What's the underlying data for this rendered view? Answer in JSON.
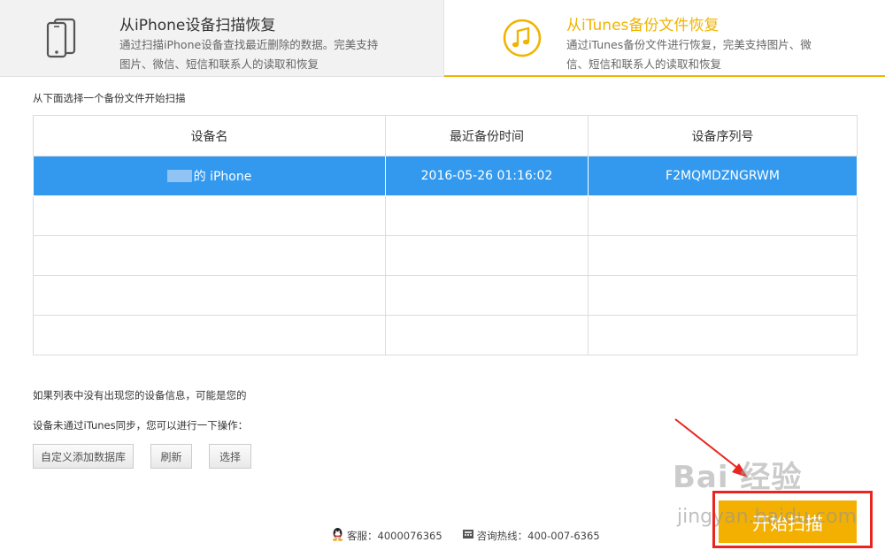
{
  "tabs": {
    "iphone": {
      "title": "从iPhone设备扫描恢复",
      "desc": "通过扫描iPhone设备查找最近删除的数据。完美支持图片、微信、短信和联系人的读取和恢复",
      "icon": "phone-icon"
    },
    "itunes": {
      "title": "从iTunes备份文件恢复",
      "desc": "通过iTunes备份文件进行恢复，完美支持图片、微信、短信和联系人的读取和恢复",
      "icon": "music-note-icon"
    }
  },
  "instruction": "从下面选择一个备份文件开始扫描",
  "table": {
    "headers": [
      "设备名",
      "最近备份时间",
      "设备序列号"
    ],
    "rows": [
      {
        "name": "的 iPhone",
        "time": "2016-05-26  01:16:02",
        "serial": "F2MQMDZNGRWM"
      }
    ]
  },
  "notes": {
    "line1": "如果列表中没有出现您的设备信息，可能是您的",
    "line2": "设备未通过iTunes同步，您可以进行一下操作："
  },
  "buttons": {
    "custom_db": "自定义添加数据库",
    "refresh": "刷新",
    "select": "选择",
    "start_scan": "开始扫描"
  },
  "footer": {
    "service": "客服：4000076365",
    "hotline": "咨询热线：400-007-6365"
  },
  "watermark": {
    "logo": "Bai 经验",
    "url": "jingyan.baidu.com"
  },
  "colors": {
    "accent": "#f0b400",
    "selected_row": "#3399ee",
    "start_button": "#f3b001",
    "annotation": "#e8261f"
  }
}
